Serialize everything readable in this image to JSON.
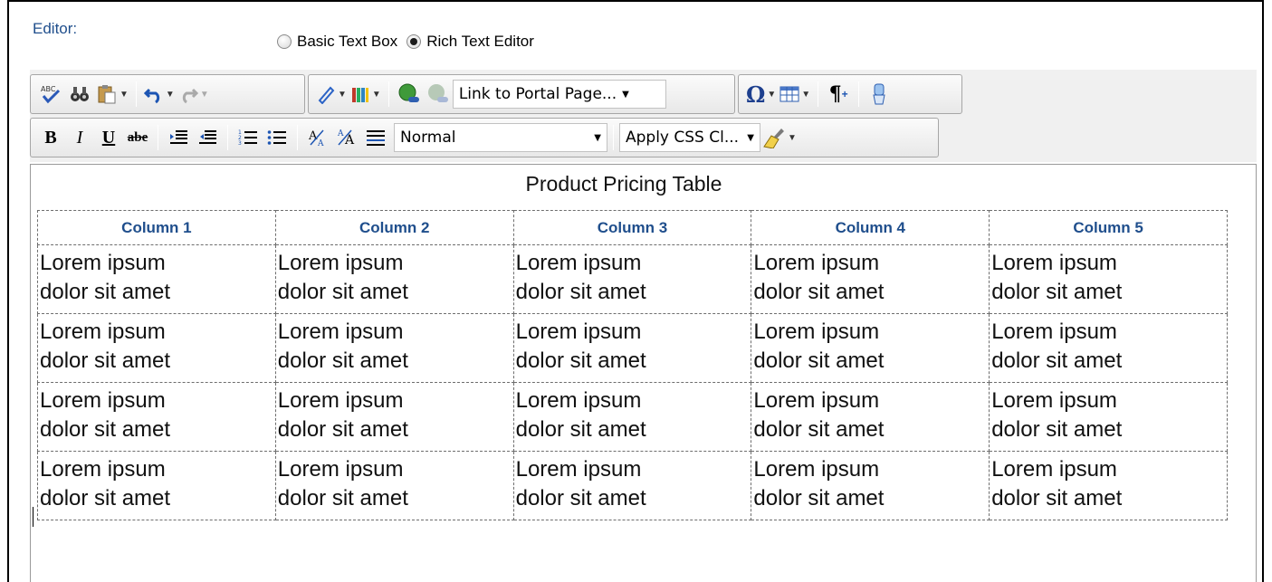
{
  "editor_label": "Editor:",
  "mode": {
    "options": [
      {
        "label": "Basic Text Box",
        "selected": false
      },
      {
        "label": "Rich Text Editor",
        "selected": true
      }
    ]
  },
  "toolbar": {
    "link_dropdown": "Link to Portal Page...",
    "format_dropdown": "Normal",
    "css_dropdown": "Apply CSS Cl...",
    "icons_row1": [
      "spellcheck-icon",
      "find-replace-icon",
      "paste-icon",
      "undo-icon",
      "redo-icon",
      "highlight-color-icon",
      "font-color-icon",
      "insert-link-icon",
      "remove-link-icon",
      "special-char-icon",
      "insert-table-icon",
      "paragraph-icon",
      "clean-format-icon"
    ],
    "icons_row2": [
      "bold-icon",
      "italic-icon",
      "underline-icon",
      "strikethrough-icon",
      "indent-icon",
      "outdent-icon",
      "numbered-list-icon",
      "bulleted-list-icon",
      "superscript-icon",
      "subscript-icon",
      "justify-icon",
      "format-painter-icon"
    ],
    "labels": {
      "bold": "B",
      "italic": "I",
      "underline": "U",
      "strike": "abe",
      "omega": "Ω",
      "pilcrow": "¶"
    }
  },
  "content": {
    "caption": "Product Pricing Table",
    "columns": [
      "Column 1",
      "Column 2",
      "Column 3",
      "Column 4",
      "Column 5"
    ],
    "rows": [
      [
        "Lorem ipsum\ndolor sit amet",
        "Lorem ipsum\ndolor sit amet",
        "Lorem ipsum\ndolor sit amet",
        "Lorem ipsum\ndolor sit amet",
        "Lorem ipsum\ndolor sit amet"
      ],
      [
        "Lorem ipsum\ndolor sit amet",
        " Lorem ipsum\ndolor sit amet",
        " Lorem ipsum\ndolor sit amet",
        " Lorem ipsum\ndolor sit amet",
        "Lorem ipsum\ndolor sit amet"
      ],
      [
        " Lorem ipsum\ndolor sit amet",
        " Lorem ipsum\ndolor sit amet",
        " Lorem ipsum\ndolor sit amet",
        " Lorem ipsum\ndolor sit amet",
        " Lorem ipsum\ndolor sit amet"
      ],
      [
        " Lorem ipsum\ndolor sit amet",
        " Lorem ipsum\ndolor sit amet",
        " Lorem ipsum\ndolor sit amet",
        " Lorem ipsum\ndolor sit amet",
        " Lorem ipsum\ndolor sit amet"
      ]
    ]
  },
  "colors": {
    "accent_text": "#1f4e8c",
    "toolbar_bg": "#f0f0f0"
  }
}
